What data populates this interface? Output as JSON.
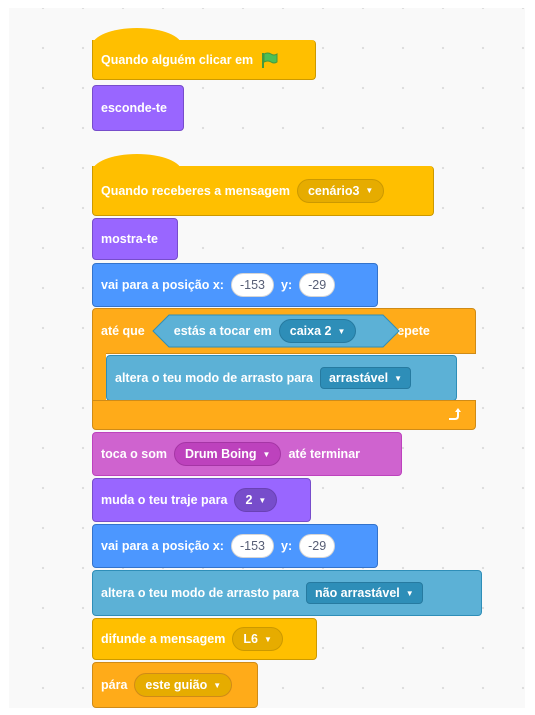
{
  "script1": {
    "hat_prefix": "Quando alguém clicar em",
    "flag_icon": "green-flag-icon",
    "hide": "esconde-te"
  },
  "script2": {
    "hat_prefix": "Quando receberes a mensagem",
    "hat_message": "cenário3",
    "show": "mostra-te",
    "goto1": {
      "label": "vai para a posição x:",
      "x": "-153",
      "ylabel": "y:",
      "y": "-29"
    },
    "repeat": {
      "prefix": "até que",
      "cond_label": "estás a tocar em",
      "cond_target": "caixa 2",
      "suffix": ", repete",
      "loop_icon": "loop-arrow-icon"
    },
    "drag1": {
      "label": "altera o teu modo de arrasto para",
      "value": "arrastável"
    },
    "sound": {
      "prefix": "toca o som",
      "value": "Drum Boing",
      "suffix": "até terminar"
    },
    "costume": {
      "label": "muda o teu traje para",
      "value": "2"
    },
    "goto2": {
      "label": "vai para a posição x:",
      "x": "-153",
      "ylabel": "y:",
      "y": "-29"
    },
    "drag2": {
      "label": "altera o teu modo de arrasto para",
      "value": "não arrastável"
    },
    "broadcast": {
      "label": "difunde a mensagem",
      "value": "L6"
    },
    "stop": {
      "label": "pára",
      "value": "este guião"
    }
  },
  "colors": {
    "events": "#ffbf00",
    "control": "#ffab19",
    "looks": "#9966ff",
    "motion": "#4c97ff",
    "sensing": "#5cb1d6",
    "sound": "#cf63cf"
  }
}
